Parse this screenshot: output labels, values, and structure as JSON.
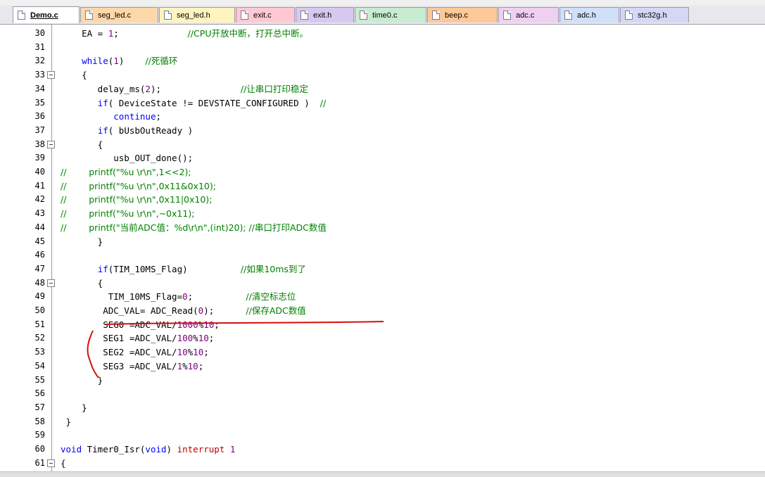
{
  "tabs": [
    {
      "label": "Demo.c",
      "active": true
    },
    {
      "label": "seg_led.c",
      "color": "#ffd8a8"
    },
    {
      "label": "seg_led.h",
      "color": "#fff4c0"
    },
    {
      "label": "exit.c",
      "color": "#ffc8d4"
    },
    {
      "label": "exit.h",
      "color": "#d8c8f0"
    },
    {
      "label": "time0.c",
      "color": "#c8ecd0"
    },
    {
      "label": "beep.c",
      "color": "#ffc898"
    },
    {
      "label": "adc.c",
      "color": "#f0d0f0"
    },
    {
      "label": "adc.h",
      "color": "#cfe0f8"
    },
    {
      "label": "stc32g.h",
      "color": "#d4d8f4"
    }
  ],
  "lines": [
    {
      "n": "30",
      "t": [
        [
          "pl",
          "    EA = "
        ],
        [
          "num",
          "1"
        ],
        [
          "pl",
          ";             "
        ],
        [
          "com",
          "//CPU开放中断，打开总中断。"
        ]
      ]
    },
    {
      "n": "31",
      "t": []
    },
    {
      "n": "32",
      "t": [
        [
          "pl",
          "    "
        ],
        [
          "kw",
          "while"
        ],
        [
          "pl",
          "("
        ],
        [
          "num",
          "1"
        ],
        [
          "pl",
          ")    "
        ],
        [
          "com",
          "//死循环"
        ]
      ]
    },
    {
      "n": "33",
      "fold": true,
      "t": [
        [
          "pl",
          "    {"
        ]
      ]
    },
    {
      "n": "34",
      "t": [
        [
          "pl",
          "       delay_ms("
        ],
        [
          "num",
          "2"
        ],
        [
          "pl",
          ");               "
        ],
        [
          "com",
          "//让串口打印稳定"
        ]
      ]
    },
    {
      "n": "35",
      "t": [
        [
          "pl",
          "       "
        ],
        [
          "kw",
          "if"
        ],
        [
          "pl",
          "( DeviceState != DEVSTATE_CONFIGURED )  "
        ],
        [
          "com",
          "//"
        ]
      ]
    },
    {
      "n": "36",
      "t": [
        [
          "pl",
          "          "
        ],
        [
          "kw",
          "continue"
        ],
        [
          "pl",
          ";"
        ]
      ]
    },
    {
      "n": "37",
      "t": [
        [
          "pl",
          "       "
        ],
        [
          "kw",
          "if"
        ],
        [
          "pl",
          "( bUsbOutReady )"
        ]
      ]
    },
    {
      "n": "38",
      "fold": true,
      "t": [
        [
          "pl",
          "       {"
        ]
      ]
    },
    {
      "n": "39",
      "t": [
        [
          "pl",
          "          usb_OUT_done();"
        ]
      ]
    },
    {
      "n": "40",
      "t": [
        [
          "com",
          "//        printf(\"%u \\r\\n\",1<<2);"
        ]
      ]
    },
    {
      "n": "41",
      "t": [
        [
          "com",
          "//        printf(\"%u \\r\\n\",0x11&0x10);"
        ]
      ]
    },
    {
      "n": "42",
      "t": [
        [
          "com",
          "//        printf(\"%u \\r\\n\",0x11|0x10);"
        ]
      ]
    },
    {
      "n": "43",
      "t": [
        [
          "com",
          "//        printf(\"%u \\r\\n\",~0x11);"
        ]
      ]
    },
    {
      "n": "44",
      "t": [
        [
          "com",
          "//        printf(\"当前ADC值：%d\\r\\n\",(int)20); //串口打印ADC数值"
        ]
      ]
    },
    {
      "n": "45",
      "t": [
        [
          "pl",
          "       }"
        ]
      ]
    },
    {
      "n": "46",
      "t": []
    },
    {
      "n": "47",
      "t": [
        [
          "pl",
          "       "
        ],
        [
          "kw",
          "if"
        ],
        [
          "pl",
          "(TIM_10MS_Flag)          "
        ],
        [
          "com",
          "//如果10ms到了"
        ]
      ]
    },
    {
      "n": "48",
      "fold": true,
      "t": [
        [
          "pl",
          "       {"
        ]
      ]
    },
    {
      "n": "49",
      "t": [
        [
          "pl",
          "         TIM_10MS_Flag="
        ],
        [
          "num",
          "0"
        ],
        [
          "pl",
          ";          "
        ],
        [
          "com",
          "//清空标志位"
        ]
      ]
    },
    {
      "n": "50",
      "t": [
        [
          "pl",
          "        ADC_VAL= ADC_Read("
        ],
        [
          "num",
          "0"
        ],
        [
          "pl",
          ");      "
        ],
        [
          "com",
          "//保存ADC数值"
        ]
      ]
    },
    {
      "n": "51",
      "t": [
        [
          "pl",
          "        SEG0 =ADC_VAL/"
        ],
        [
          "num",
          "1000"
        ],
        [
          "pl",
          "%"
        ],
        [
          "num",
          "10"
        ],
        [
          "pl",
          ";"
        ]
      ]
    },
    {
      "n": "52",
      "t": [
        [
          "pl",
          "        SEG1 =ADC_VAL/"
        ],
        [
          "num",
          "100"
        ],
        [
          "pl",
          "%"
        ],
        [
          "num",
          "10"
        ],
        [
          "pl",
          ";"
        ]
      ]
    },
    {
      "n": "53",
      "t": [
        [
          "pl",
          "        SEG2 =ADC_VAL/"
        ],
        [
          "num",
          "10"
        ],
        [
          "pl",
          "%"
        ],
        [
          "num",
          "10"
        ],
        [
          "pl",
          ";"
        ]
      ]
    },
    {
      "n": "54",
      "t": [
        [
          "pl",
          "        SEG3 =ADC_VAL/"
        ],
        [
          "num",
          "1"
        ],
        [
          "pl",
          "%"
        ],
        [
          "num",
          "10"
        ],
        [
          "pl",
          ";"
        ]
      ]
    },
    {
      "n": "55",
      "t": [
        [
          "pl",
          "       }"
        ]
      ]
    },
    {
      "n": "56",
      "t": []
    },
    {
      "n": "57",
      "t": [
        [
          "pl",
          "    }"
        ]
      ]
    },
    {
      "n": "58",
      "t": [
        [
          "pl",
          " }"
        ]
      ]
    },
    {
      "n": "59",
      "t": []
    },
    {
      "n": "60",
      "t": [
        [
          "kw",
          "void"
        ],
        [
          "pl",
          " Timer0_Isr("
        ],
        [
          "kw",
          "void"
        ],
        [
          "pl",
          ") "
        ],
        [
          "red",
          "interrupt"
        ],
        [
          "pl",
          " "
        ],
        [
          "num",
          "1"
        ]
      ]
    },
    {
      "n": "61",
      "fold": true,
      "t": [
        [
          "pl",
          "{"
        ]
      ]
    }
  ],
  "colors": {
    "keyword": "#0000ff",
    "number": "#800080",
    "comment": "#008000",
    "annotation": "#d01010"
  }
}
